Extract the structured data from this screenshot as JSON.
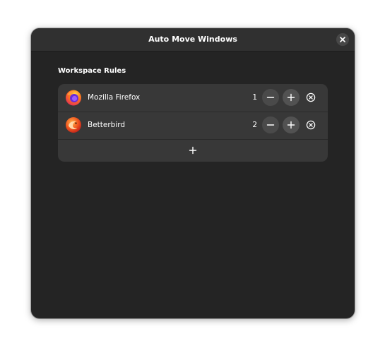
{
  "window": {
    "title": "Auto Move Windows"
  },
  "section": {
    "title": "Workspace Rules"
  },
  "rules": [
    {
      "app": "Mozilla Firefox",
      "workspace": "1",
      "icon": "firefox-icon"
    },
    {
      "app": "Betterbird",
      "workspace": "2",
      "icon": "betterbird-icon"
    }
  ],
  "colors": {
    "window_bg": "#242424",
    "titlebar_bg": "#303030",
    "list_bg": "#383838",
    "button_bg": "#4a4a4a",
    "text": "#ffffff"
  },
  "icons": {
    "close": "close-icon",
    "minus": "minus-icon",
    "plus": "plus-icon",
    "remove": "remove-circle-icon",
    "add": "add-icon"
  }
}
